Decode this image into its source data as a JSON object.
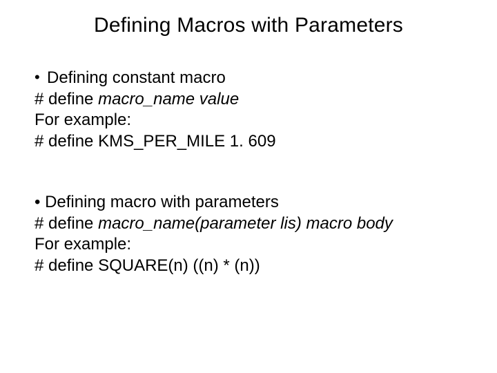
{
  "title": "Defining Macros with Parameters",
  "section1": {
    "bullet": "•",
    "heading": "Defining constant macro",
    "syntax_prefix": "# define ",
    "syntax_ital": "macro_name value",
    "example_label": "For example:",
    "example_code": "# define KMS_PER_MILE 1. 609"
  },
  "section2": {
    "bullet": "•",
    "heading": "Defining macro with parameters",
    "syntax_prefix": "# define ",
    "syntax_ital": "macro_name(parameter lis) macro body",
    "example_label": "For example:",
    "example_code": "# define SQUARE(n)  ((n) * (n))"
  }
}
